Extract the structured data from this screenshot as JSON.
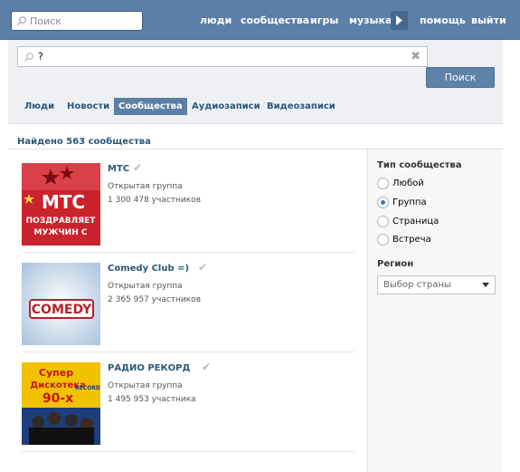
{
  "topbar": {
    "search_placeholder": "Поиск",
    "nav": [
      "люди",
      "сообщества",
      "игры",
      "музыка",
      "помощь",
      "выйти"
    ]
  },
  "search": {
    "query": "?",
    "button_label": "Поиск",
    "clear_icon": "✖"
  },
  "tabs": [
    {
      "label": "Люди",
      "active": false
    },
    {
      "label": "Новости",
      "active": false
    },
    {
      "label": "Сообщества",
      "active": true
    },
    {
      "label": "Аудиозаписи",
      "active": false
    },
    {
      "label": "Видеозаписи",
      "active": false
    }
  ],
  "results_header": "Найдено 563 сообщества",
  "results": [
    {
      "name": "МТС",
      "type": "Открытая группа",
      "members": "1 300 478 участников",
      "thumb_text": [
        "МТС",
        "ПОЗДРАВЛЯЕТ",
        "МУЖЧИН С"
      ]
    },
    {
      "name": "Comedy Club =)",
      "type": "Открытая группа",
      "members": "2 365 957 участников",
      "thumb_text": [
        "COMEDY"
      ]
    },
    {
      "name": "РАДИО РЕКОРД",
      "type": "Открытая группа",
      "members": "1 495 953 участника",
      "thumb_text": [
        "Супер",
        "Дискотека",
        "90-х",
        "RECORD"
      ]
    }
  ],
  "filters": {
    "type_heading": "Тип сообщества",
    "type_options": [
      {
        "label": "Любой",
        "selected": false
      },
      {
        "label": "Группа",
        "selected": true
      },
      {
        "label": "Страница",
        "selected": false
      },
      {
        "label": "Встреча",
        "selected": false
      }
    ],
    "region_heading": "Регион",
    "region_value": "Выбор страны"
  },
  "colors": {
    "topbar": "#5b7fa6",
    "link": "#2b587a",
    "active_tab": "#5b7fa6"
  },
  "icons": {
    "search": "search-icon",
    "verified": "checkmark-icon",
    "play": "play-icon",
    "dropdown": "chevron-down-icon"
  }
}
